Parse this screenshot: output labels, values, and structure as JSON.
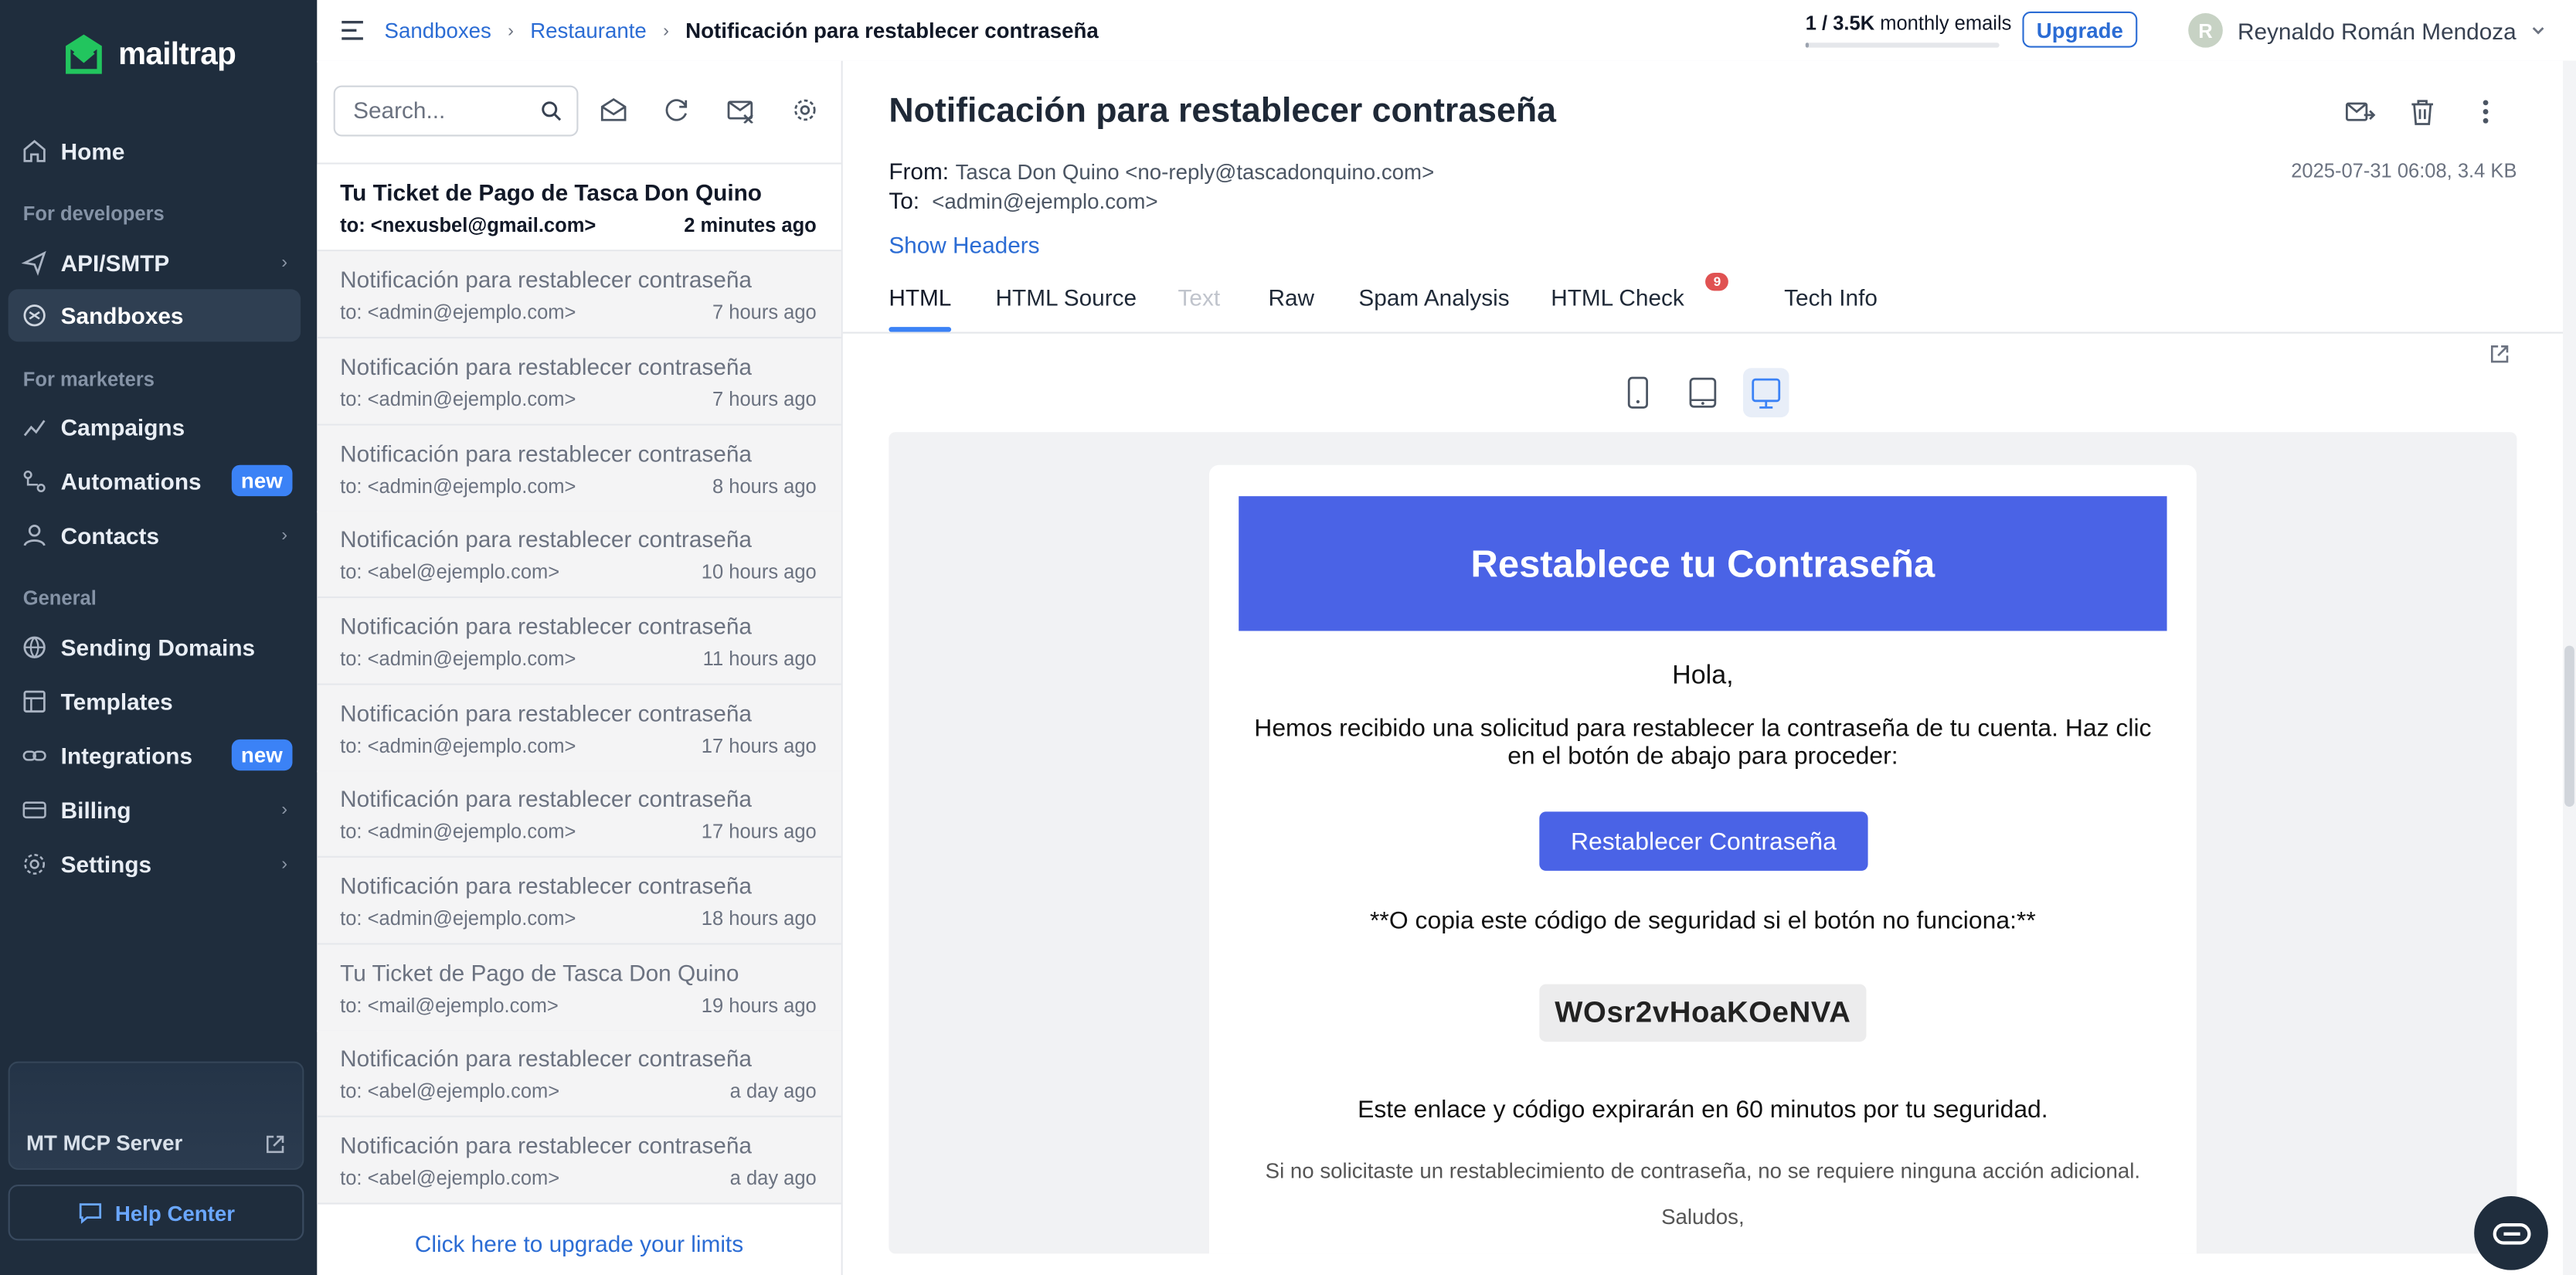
{
  "brand": {
    "name": "mailtrap"
  },
  "sidebar": {
    "items": [
      {
        "label": "Home",
        "icon": "home-icon"
      },
      {
        "label": "API/SMTP",
        "icon": "send-icon"
      },
      {
        "label": "Sandboxes",
        "icon": "sandbox-icon"
      },
      {
        "label": "Campaigns",
        "icon": "chart-icon"
      },
      {
        "label": "Automations",
        "icon": "automation-icon",
        "badge": "new"
      },
      {
        "label": "Contacts",
        "icon": "user-icon"
      },
      {
        "label": "Sending Domains",
        "icon": "globe-icon"
      },
      {
        "label": "Templates",
        "icon": "template-icon"
      },
      {
        "label": "Integrations",
        "icon": "link-icon",
        "badge": "new"
      },
      {
        "label": "Billing",
        "icon": "card-icon"
      },
      {
        "label": "Settings",
        "icon": "gear-icon"
      }
    ],
    "sections": {
      "developers": "For developers",
      "marketers": "For marketers",
      "general": "General"
    },
    "mcp_label": "MT MCP Server",
    "help_label": "Help Center"
  },
  "topbar": {
    "breadcrumb": [
      "Sandboxes",
      "Restaurante",
      "Notificación para restablecer contraseña"
    ],
    "quota_used": "1 / 3.5K",
    "quota_suffix": " monthly emails",
    "quota_fraction": 0.0003,
    "upgrade_label": "Upgrade",
    "user_initial": "R",
    "user_name": "Reynaldo Román Mendoza"
  },
  "list": {
    "search_placeholder": "Search...",
    "messages": [
      {
        "subject": "Tu Ticket de Pago de Tasca Don Quino",
        "to": "to: <nexusbel@gmail.com>",
        "time": "2 minutes ago",
        "unread": true
      },
      {
        "subject": "Notificación para restablecer contraseña",
        "to": "to: <admin@ejemplo.com>",
        "time": "7 hours ago"
      },
      {
        "subject": "Notificación para restablecer contraseña",
        "to": "to: <admin@ejemplo.com>",
        "time": "7 hours ago"
      },
      {
        "subject": "Notificación para restablecer contraseña",
        "to": "to: <admin@ejemplo.com>",
        "time": "8 hours ago"
      },
      {
        "subject": "Notificación para restablecer contraseña",
        "to": "to: <abel@ejemplo.com>",
        "time": "10 hours ago"
      },
      {
        "subject": "Notificación para restablecer contraseña",
        "to": "to: <admin@ejemplo.com>",
        "time": "11 hours ago"
      },
      {
        "subject": "Notificación para restablecer contraseña",
        "to": "to: <admin@ejemplo.com>",
        "time": "17 hours ago"
      },
      {
        "subject": "Notificación para restablecer contraseña",
        "to": "to: <admin@ejemplo.com>",
        "time": "17 hours ago"
      },
      {
        "subject": "Notificación para restablecer contraseña",
        "to": "to: <admin@ejemplo.com>",
        "time": "18 hours ago"
      },
      {
        "subject": "Tu Ticket de Pago de Tasca Don Quino",
        "to": "to: <mail@ejemplo.com>",
        "time": "19 hours ago"
      },
      {
        "subject": "Notificación para restablecer contraseña",
        "to": "to: <abel@ejemplo.com>",
        "time": "a day ago"
      },
      {
        "subject": "Notificación para restablecer contraseña",
        "to": "to: <abel@ejemplo.com>",
        "time": "a day ago"
      }
    ],
    "upgrade_link": "Click here to upgrade your limits"
  },
  "detail": {
    "title": "Notificación para restablecer contraseña",
    "from_label": "From:",
    "from": "Tasca Don Quino <no-reply@tascadonquino.com>",
    "to_label": "To:",
    "to": "<admin@ejemplo.com>",
    "date_size": "2025-07-31 06:08, 3.4 KB",
    "show_headers": "Show Headers",
    "tabs": [
      {
        "label": "HTML",
        "state": "active"
      },
      {
        "label": "HTML Source"
      },
      {
        "label": "Text",
        "state": "disabled"
      },
      {
        "label": "Raw"
      },
      {
        "label": "Spam Analysis"
      },
      {
        "label": "HTML Check",
        "count": "9"
      },
      {
        "label": "Tech Info"
      }
    ]
  },
  "email": {
    "header": "Restablece tu Contraseña",
    "greeting": "Hola,",
    "body": "Hemos recibido una solicitud para restablecer la contraseña de tu cuenta. Haz clic en el botón de abajo para proceder:",
    "button": "Restablecer Contraseña",
    "code_intro": "**O copia este código de seguridad si el botón no funciona:**",
    "code": "WOsr2vHoaKOeNVA",
    "expiry": "Este enlace y código expirarán en 60 minutos por tu seguridad.",
    "note": "Si no solicitaste un restablecimiento de contraseña, no se requiere ninguna acción adicional.",
    "closing": "Saludos,"
  },
  "colors": {
    "sidebar": "#1f2d3d",
    "accent": "#2b6cd4",
    "email_brand": "#4a63e6",
    "badge_new": "#3b82f6",
    "check_badge": "#e05252"
  }
}
